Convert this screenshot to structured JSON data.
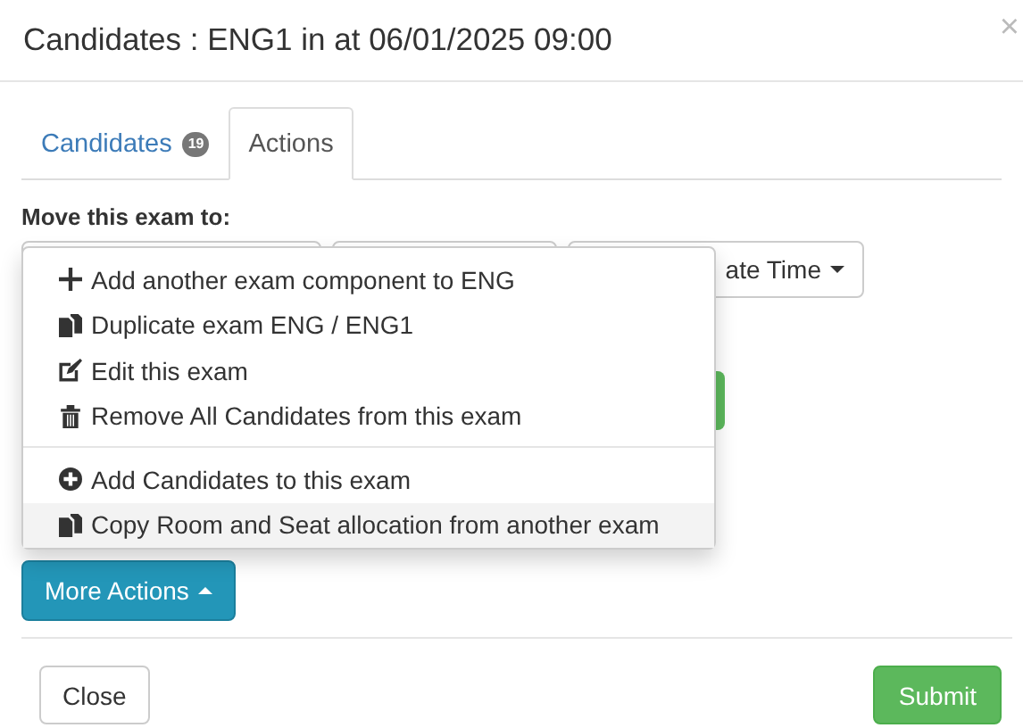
{
  "modal": {
    "title": "Candidates : ENG1 in at 06/01/2025 09:00",
    "close": "×"
  },
  "tabs": [
    {
      "label": "Candidates",
      "badge": "19",
      "selected": false
    },
    {
      "label": "Actions",
      "selected": true
    }
  ],
  "move_label": "Move this exam to:",
  "date_dropdown": {
    "label": "ate Time"
  },
  "menu_groups": [
    [
      {
        "kind": "add",
        "label": "Add another exam component to ENG",
        "selected": false
      },
      {
        "kind": "duplicate",
        "label": "Duplicate exam ENG / ENG1",
        "selected": false
      },
      {
        "kind": "edit",
        "label": "Edit this exam",
        "selected": false
      },
      {
        "kind": "remove",
        "label": "Remove All Candidates from this exam",
        "selected": false
      }
    ],
    [
      {
        "kind": "add-candidates",
        "label": "Add Candidates to this exam",
        "selected": false
      },
      {
        "kind": "duplicate",
        "label": "Copy Room and Seat allocation from another exam",
        "selected": true
      }
    ]
  ],
  "more_actions": {
    "label": "More Actions",
    "expanded": true
  },
  "footer": {
    "close": "Close",
    "submit": "Submit"
  }
}
